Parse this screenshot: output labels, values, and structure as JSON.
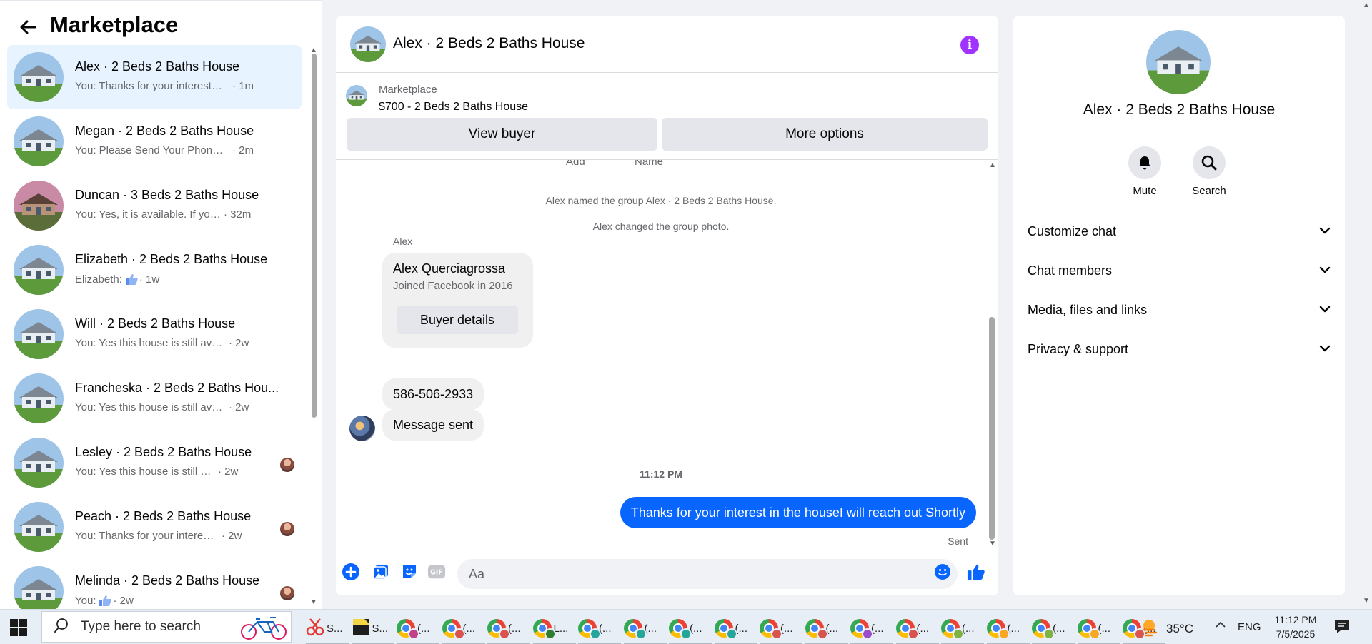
{
  "sidebar": {
    "title": "Marketplace",
    "conversations": [
      {
        "name": "Alex · 2 Beds 2 Baths House",
        "preview": "You: Thanks for your interest in the...",
        "time": "· 1m",
        "active": true,
        "avatar": "house-icon"
      },
      {
        "name": "Megan · 2 Beds 2 Baths House",
        "preview": "You: Please Send Your Phone Num...",
        "time": "· 2m",
        "avatar": "house-icon"
      },
      {
        "name": "Duncan · 3 Beds 2 Baths House",
        "preview": "You: Yes, it is available. If you are i...",
        "time": "· 32m",
        "avatar": "sunset-house-icon"
      },
      {
        "name": "Elizabeth · 2 Beds 2 Baths House",
        "preview": "Elizabeth:",
        "time": "· 1w",
        "avatar": "house-icon",
        "thumb_icon": "thumbs-up-icon"
      },
      {
        "name": "Will · 2 Beds 2 Baths House",
        "preview": "You: Yes this house is still available ...",
        "time": "· 2w",
        "avatar": "house-icon"
      },
      {
        "name": "Francheska · 2 Beds 2 Baths Hou...",
        "preview": "You: Yes this house is still available ...",
        "time": "· 2w",
        "avatar": "house-icon"
      },
      {
        "name": "Lesley · 2 Beds 2 Baths House",
        "preview": "You: Yes this house is still availa...",
        "time": "· 2w",
        "avatar": "house-icon",
        "seen_avatar": true
      },
      {
        "name": "Peach · 2 Beds 2 Baths House",
        "preview": "You: Thanks for your interest in t...",
        "time": "· 2w",
        "avatar": "house-icon",
        "seen_avatar": true
      },
      {
        "name": "Melinda · 2 Beds 2 Baths House",
        "preview": "You:",
        "time": "· 2w",
        "avatar": "house-icon",
        "seen_avatar": true,
        "thumb_icon": "thumbs-up-icon"
      }
    ]
  },
  "chat": {
    "title": "Alex · 2 Beds 2 Baths House",
    "listing": {
      "label": "Marketplace",
      "price_title": "$700 - 2 Beds 2 Baths House",
      "view_buyer": "View buyer",
      "more_options": "More options"
    },
    "cut_labels": [
      "Add",
      "Name"
    ],
    "system_messages": [
      "Alex named the group Alex · 2 Beds 2 Baths House.",
      "Alex changed the group photo."
    ],
    "sender": "Alex",
    "contact_card": {
      "name": "Alex Querciagrossa",
      "subtitle": "Joined Facebook in 2016",
      "button": "Buyer details"
    },
    "phone": "586-506-2933",
    "message_sent": "Message sent",
    "timestamp": "11:12 PM",
    "my_message": "Thanks for your interest in the houseI will reach out Shortly",
    "status": "Sent",
    "composer": {
      "placeholder": "Aa"
    }
  },
  "info_panel": {
    "title": "Alex · 2 Beds 2 Baths House",
    "actions": {
      "mute": "Mute",
      "search": "Search"
    },
    "sections": [
      "Customize chat",
      "Chat members",
      "Media, files and links",
      "Privacy & support"
    ]
  },
  "taskbar": {
    "search_placeholder": "Type here to search",
    "apps": [
      {
        "label": "S...",
        "icon": "snip-icon"
      },
      {
        "label": "S...",
        "icon": "sticky-notes-icon"
      },
      {
        "label": "(...",
        "icon": "chrome-icon",
        "badge": "#c0408a"
      },
      {
        "label": "(...",
        "icon": "chrome-icon",
        "badge": "#d9534f"
      },
      {
        "label": "(...",
        "icon": "chrome-icon",
        "badge": "#d9534f"
      },
      {
        "label": "L...",
        "icon": "chrome-icon",
        "badge": "#2e7d32"
      },
      {
        "label": "(...",
        "icon": "chrome-icon",
        "badge": "#26a69a"
      },
      {
        "label": "(...",
        "icon": "chrome-icon",
        "badge": "#26a69a"
      },
      {
        "label": "(...",
        "icon": "chrome-icon",
        "badge": "#26a69a"
      },
      {
        "label": "(...",
        "icon": "chrome-icon",
        "badge": "#26a69a"
      },
      {
        "label": "(...",
        "icon": "chrome-icon",
        "badge": "#d9534f"
      },
      {
        "label": "(...",
        "icon": "chrome-icon",
        "badge": "#d9534f"
      },
      {
        "label": "(...",
        "icon": "chrome-icon",
        "badge": "#9c4dcc"
      },
      {
        "label": "(...",
        "icon": "chrome-icon",
        "badge": "#d9534f"
      },
      {
        "label": "(...",
        "icon": "chrome-icon",
        "badge": "#7cb342"
      },
      {
        "label": "(...",
        "icon": "chrome-icon",
        "badge": "#f9a825"
      },
      {
        "label": "(...",
        "icon": "chrome-icon",
        "badge": "#7cb342"
      },
      {
        "label": "(...",
        "icon": "chrome-icon",
        "badge": "#f9a825"
      },
      {
        "label": "(...",
        "icon": "chrome-icon",
        "badge": "#d9534f"
      }
    ],
    "weather": "35°C",
    "language": "ENG",
    "time": "11:12 PM",
    "date": "7/5/2025"
  },
  "colors": {
    "accent": "#0866ff",
    "info": "#a033ff",
    "active_row": "#e7f3ff"
  }
}
